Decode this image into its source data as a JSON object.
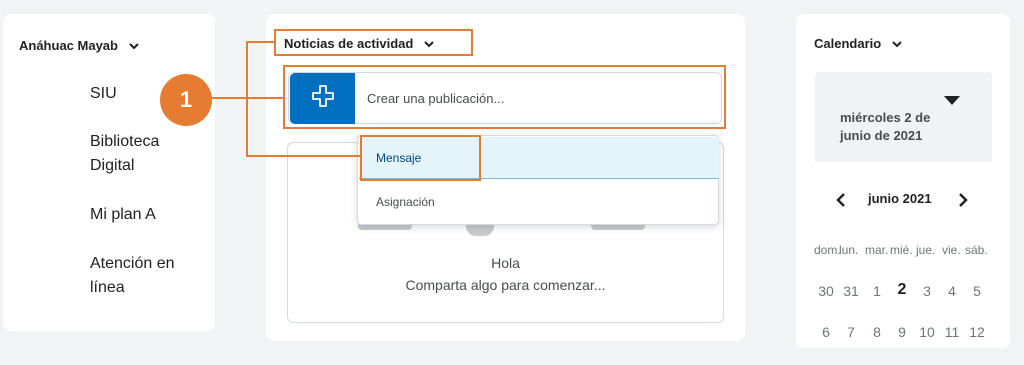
{
  "left": {
    "org_title": "Anáhuac Mayab",
    "links": [
      "SIU",
      "Biblioteca Digital",
      "Mi plan A",
      "Atención en línea"
    ]
  },
  "activity": {
    "title": "Noticias de actividad",
    "composer_placeholder": "Crear una publicación...",
    "menu": [
      "Mensaje",
      "Asignación"
    ],
    "empty_title": "Hola",
    "empty_subtitle": "Comparta algo para comenzar..."
  },
  "callout": {
    "number": "1"
  },
  "calendar": {
    "title": "Calendario",
    "selected_date": "miércoles 2 de junio de 2021",
    "month": "junio 2021",
    "weekdays": [
      "dom.",
      "lun.",
      "mar.",
      "mié.",
      "jue.",
      "vie.",
      "sáb."
    ],
    "row1": [
      "30",
      "31",
      "1",
      "2",
      "3",
      "4",
      "5"
    ],
    "row2": [
      "6",
      "7",
      "8",
      "9",
      "10",
      "11",
      "12"
    ],
    "today": "2"
  },
  "colors": {
    "accent_orange": "#e67c32",
    "primary_blue": "#006fbf"
  },
  "icons": {
    "chevron": "chevron-down-icon",
    "plus": "plus-icon",
    "prev": "chevron-left-icon",
    "next": "chevron-right-icon"
  }
}
